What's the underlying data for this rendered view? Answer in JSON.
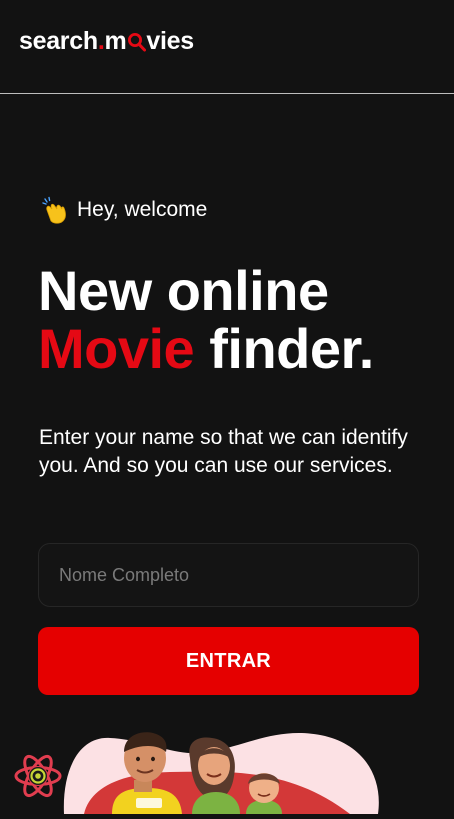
{
  "header": {
    "logo_part1": "search",
    "logo_dot": ".",
    "logo_part2": "m",
    "logo_part3": "vies",
    "logo_icon": "magnifier-icon",
    "accent_color": "#e50914"
  },
  "greeting": {
    "icon": "waving-hand-icon",
    "text": "Hey, welcome"
  },
  "hero": {
    "line1": "New online",
    "highlight": "Movie",
    "line2_rest": " finder."
  },
  "description": "Enter your name so that we can identify you. And so you can use our services.",
  "form": {
    "name_placeholder": "Nome Completo",
    "name_value": "",
    "submit_label": "ENTRAR",
    "button_color": "#e50000"
  },
  "illustration": {
    "icon": "family-illustration"
  },
  "floating_button": {
    "icon": "react-atom-icon"
  }
}
